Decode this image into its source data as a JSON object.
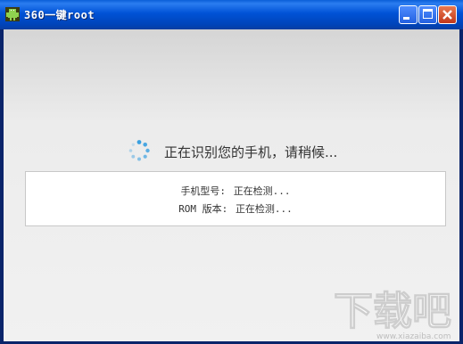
{
  "window": {
    "title": "360一键root",
    "icon": "android-robot-icon",
    "controls": {
      "minimize": "minimize-icon",
      "maximize": "maximize-icon",
      "close": "close-icon"
    }
  },
  "status": {
    "spinner_icon": "loading-spinner-icon",
    "message": "正在识别您的手机，请稍候..."
  },
  "device_info": {
    "model_label": "手机型号:",
    "model_value": "正在检测...",
    "rom_label": "ROM 版本:",
    "rom_value": "正在检测..."
  },
  "watermark": {
    "text": "下载吧",
    "url": "www.xiazaiba.com"
  },
  "colors": {
    "titlebar": "#0052d6",
    "spinner": "#3aa0e0",
    "close_button": "#c2371a"
  }
}
